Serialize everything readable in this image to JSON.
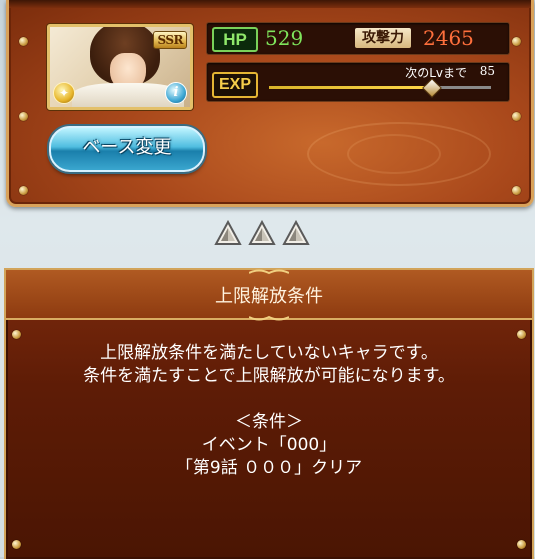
{
  "character": {
    "rarity": "SSR",
    "hp_label": "HP",
    "hp_value": "529",
    "attack_label": "攻撃力",
    "attack_value": "2465",
    "exp_label": "EXP",
    "next_level_label": "次のLvまで",
    "next_level_value": "85",
    "exp_progress": 0.73
  },
  "buttons": {
    "change_base": "ベース変更"
  },
  "condition_panel": {
    "title": "上限解放条件",
    "message_line1": "上限解放条件を満たしていないキャラです。",
    "message_line2": "条件を満たすことで上限解放が可能になります。",
    "condition_heading": "＜条件＞",
    "condition_event": "イベント「000」",
    "condition_clear": "「第9話 ０００」クリア"
  },
  "colors": {
    "hp": "#7fe55c",
    "attack": "#ff6f3c",
    "exp_bar": "#ffd84a",
    "panel_brown": "#a9481b"
  },
  "icons": [
    "element-light-icon",
    "info-icon",
    "triangle-marker-icon"
  ]
}
